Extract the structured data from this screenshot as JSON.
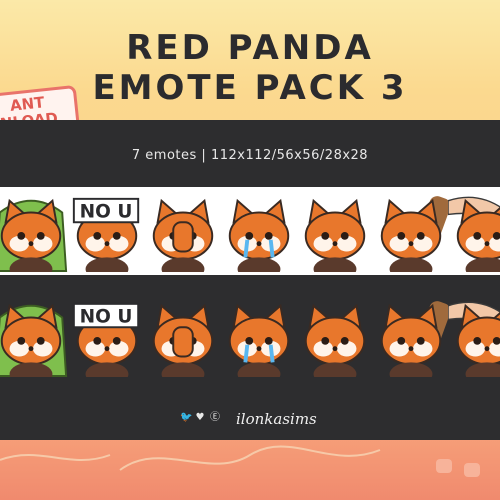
{
  "header": {
    "title_line1": "RED PANDA",
    "title_line2": "EMOTE PACK 3",
    "badge_line1": "ANT",
    "badge_line2": "NLOAD"
  },
  "info": {
    "subtitle": "7 emotes | 112x112/56x56/28x28"
  },
  "emotes": [
    {
      "name": "red-panda-in-green-hoodie",
      "sign": ""
    },
    {
      "name": "red-panda-no-u-sign",
      "sign": "NO U"
    },
    {
      "name": "red-panda-facepalm",
      "sign": ""
    },
    {
      "name": "red-panda-crying",
      "sign": ""
    },
    {
      "name": "red-panda-scared",
      "sign": ""
    },
    {
      "name": "red-panda-with-bat",
      "sign": ""
    },
    {
      "name": "red-panda-headpat",
      "sign": ""
    }
  ],
  "footer": {
    "handle": "ilonkasims",
    "icons": [
      "twitter-icon",
      "kofi-icon",
      "etsy-icon"
    ]
  },
  "colors": {
    "panel": "#2d2d2f",
    "fur": "#e8772c",
    "accent": "#e05a52"
  }
}
